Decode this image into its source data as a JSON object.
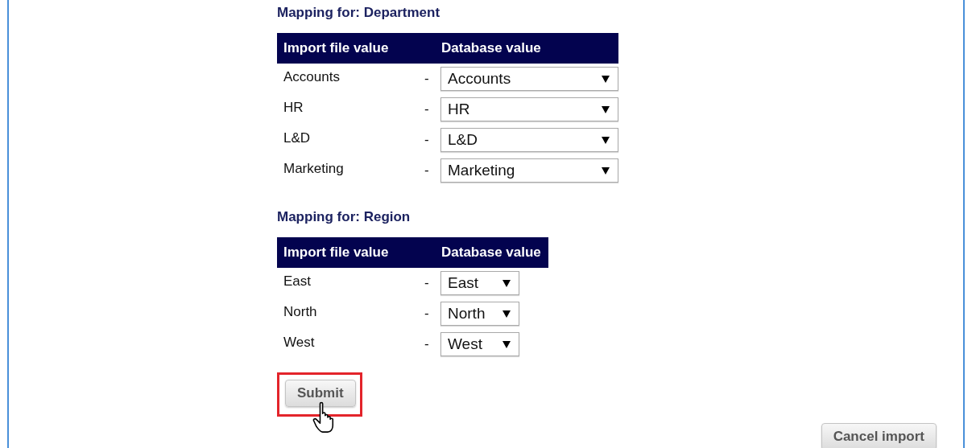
{
  "mappings": [
    {
      "title": "Mapping for: Department",
      "columns": [
        "Import file value",
        "Database value"
      ],
      "rows": [
        {
          "source": "Accounts",
          "separator": "-",
          "value": "Accounts"
        },
        {
          "source": "HR",
          "separator": "-",
          "value": "HR"
        },
        {
          "source": "L&D",
          "separator": "-",
          "value": "L&D"
        },
        {
          "source": "Marketing",
          "separator": "-",
          "value": "Marketing"
        }
      ]
    },
    {
      "title": "Mapping for: Region",
      "columns": [
        "Import file value",
        "Database value"
      ],
      "rows": [
        {
          "source": "East",
          "separator": "-",
          "value": "East"
        },
        {
          "source": "North",
          "separator": "-",
          "value": "North"
        },
        {
          "source": "West",
          "separator": "-",
          "value": "West"
        }
      ]
    }
  ],
  "submit": {
    "label": "Submit",
    "highlighted": true
  },
  "cancel": {
    "label": "Cancel import"
  }
}
